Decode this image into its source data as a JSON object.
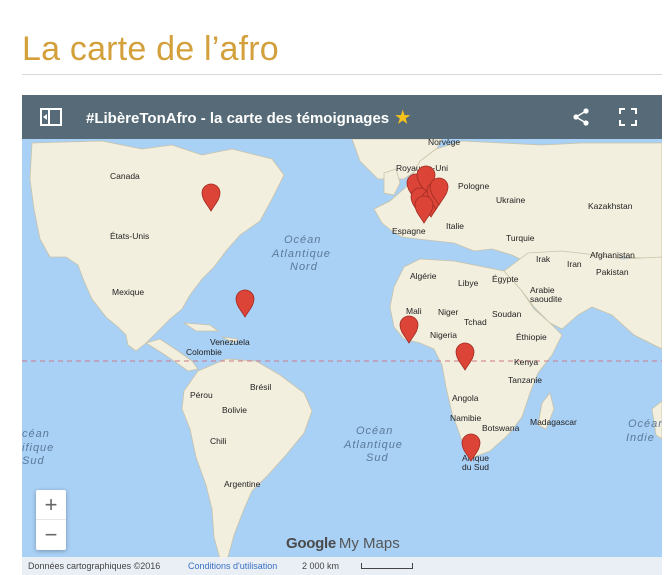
{
  "page": {
    "title": "La carte de l’afro"
  },
  "map": {
    "header": {
      "title": "#LibèreTonAfro - la carte des témoignages",
      "star": "★",
      "icons": [
        "legend-icon",
        "star-icon",
        "share-icon",
        "fullscreen-icon"
      ]
    },
    "labels": {
      "canada": "Canada",
      "usa": "États-Unis",
      "mexico": "Mexique",
      "venezuela": "Venezuela",
      "colombia": "Colombie",
      "brazil": "Brésil",
      "peru": "Pérou",
      "bolivia": "Bolivie",
      "chile": "Chili",
      "argentina": "Argentine",
      "ocean_atl_n_1": "Océan",
      "ocean_atl_n_2": "Atlantique",
      "ocean_atl_n_3": "Nord",
      "ocean_atl_s_1": "Océan",
      "ocean_atl_s_2": "Atlantique",
      "ocean_atl_s_3": "Sud",
      "ocean_pac_s_1": "céan",
      "ocean_pac_s_2": "ifique",
      "ocean_pac_s_3": "Sud",
      "ocean_ind_1": "Océan",
      "ocean_ind_2": "Indie",
      "norway": "Norvège",
      "uk": "Royaume-Uni",
      "poland": "Pologne",
      "ukraine": "Ukraine",
      "kazakhstan": "Kazakhstan",
      "spain": "Espagne",
      "italy": "Italie",
      "turkey": "Turquie",
      "iraq": "Irak",
      "iran": "Iran",
      "afghanistan": "Afghanistan",
      "pakistan": "Pakistan",
      "algeria": "Algérie",
      "libya": "Libye",
      "egypt": "Égypte",
      "saudi_1": "Arabie",
      "saudi_2": "saoudite",
      "mali": "Mali",
      "niger": "Niger",
      "chad": "Tchad",
      "sudan": "Soudan",
      "nigeria": "Nigeria",
      "ethiopia": "Éthiopie",
      "kenya": "Kenya",
      "tanzania": "Tanzanie",
      "angola": "Angola",
      "namibia": "Namibie",
      "botswana": "Botswana",
      "madagascar": "Madagascar",
      "south_africa_1": "Afrique",
      "south_africa_2": "du Sud"
    },
    "marker_color": "#db4437",
    "zoom_in": "+",
    "zoom_out": "−",
    "branding": {
      "google": "Google",
      "mymaps": "My Maps"
    },
    "footer": {
      "data": "Données cartographiques ©2016",
      "terms": "Conditions d'utilisation",
      "scale": "2 000 km"
    },
    "colors": {
      "header": "#566b77",
      "ocean": "#a9d0f5",
      "land": "#f3efdf",
      "marker": "#db4437",
      "title": "#d3a03c"
    }
  }
}
